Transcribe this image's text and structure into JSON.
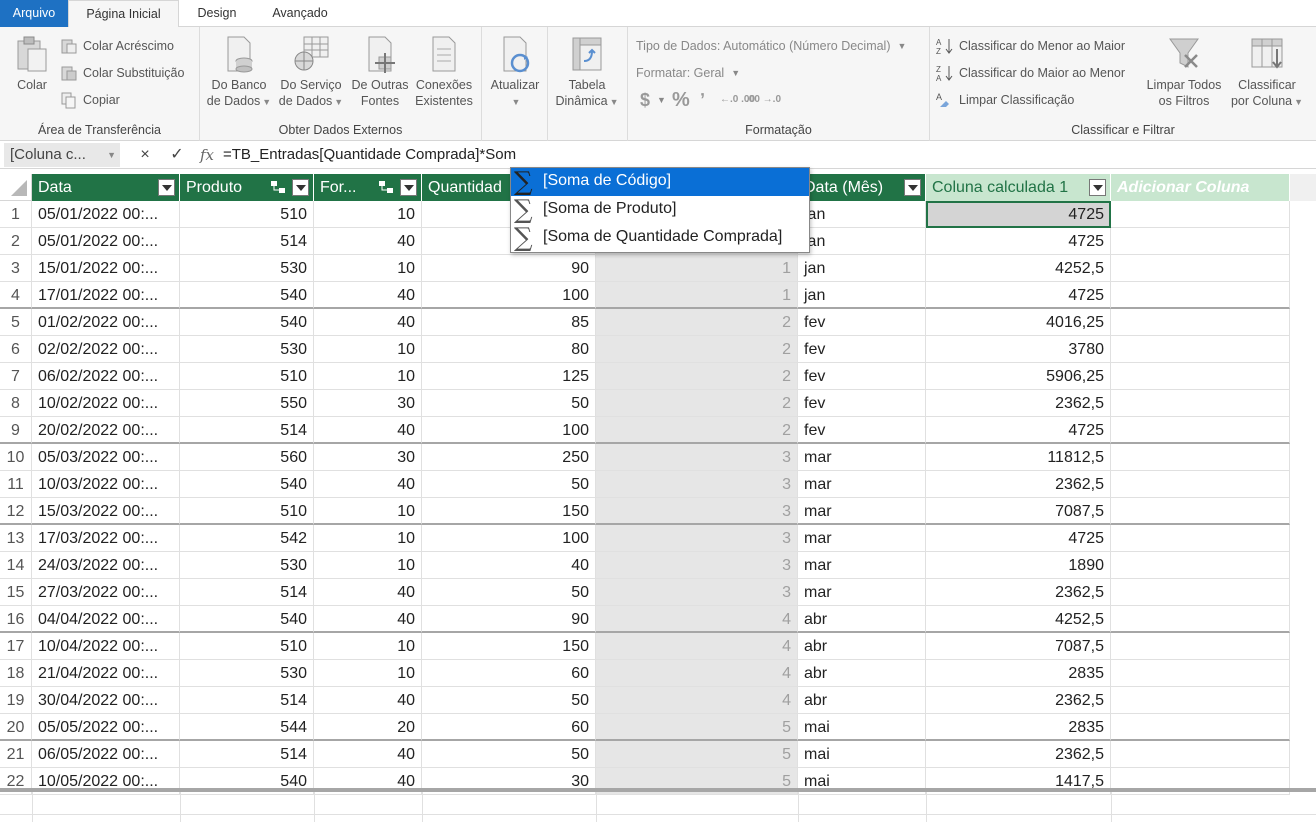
{
  "tabs": [
    {
      "label": "Arquivo"
    },
    {
      "label": "Página Inicial"
    },
    {
      "label": "Design"
    },
    {
      "label": "Avançado"
    }
  ],
  "ribbon": {
    "clipboard": {
      "paste_label": "Colar",
      "paste_append": "Colar Acréscimo",
      "paste_replace": "Colar Substituição",
      "copy": "Copiar",
      "group": "Área de Transferência"
    },
    "external": {
      "from_db_1": "Do Banco",
      "from_db_2": "de Dados",
      "from_service_1": "Do Serviço",
      "from_service_2": "de Dados",
      "other_1": "De Outras",
      "other_2": "Fontes",
      "existing_1": "Conexões",
      "existing_2": "Existentes",
      "group": "Obter Dados Externos"
    },
    "refresh_label": "Atualizar",
    "pivot_1": "Tabela",
    "pivot_2": "Dinâmica",
    "formatting": {
      "data_type": "Tipo de Dados: Automático (Número Decimal)",
      "format": "Formatar: Geral",
      "currency": "$",
      "percent": "%",
      "comma": "ʼ",
      "inc_decimal": "←.0 .00",
      "dec_decimal": ".00 →.0",
      "group": "Formatação"
    },
    "sort": {
      "asc": "Classificar do Menor ao Maior",
      "desc": "Classificar do Maior ao Menor",
      "clear": "Limpar Classificação",
      "clear_filters_1": "Limpar Todos",
      "clear_filters_2": "os Filtros",
      "by_col_1": "Classificar",
      "by_col_2": "por Coluna",
      "group": "Classificar e Filtrar"
    }
  },
  "formula_bar": {
    "name_box": "[Coluna c...",
    "cancel": "×",
    "confirm": "✓",
    "fx": "fx",
    "formula": "=TB_Entradas[Quantidade Comprada]*Som"
  },
  "columns": [
    {
      "label": "Data"
    },
    {
      "label": "Produto"
    },
    {
      "label": "For..."
    },
    {
      "label": "Quantidad"
    },
    {
      "label": ""
    },
    {
      "label": "Data (Mês)"
    },
    {
      "label": "Coluna calculada 1"
    },
    {
      "label": "Adicionar Coluna"
    }
  ],
  "autocomplete": [
    {
      "label": "[Soma de Código]"
    },
    {
      "label": "[Soma de Produto]"
    },
    {
      "label": "[Soma de Quantidade Comprada]"
    }
  ],
  "rows": [
    {
      "n": "1",
      "date": "05/01/2022 00:...",
      "prod": "510",
      "forn": "10",
      "qty": "",
      "m": "",
      "mes": "jan",
      "calc": "4725"
    },
    {
      "n": "2",
      "date": "05/01/2022 00:...",
      "prod": "514",
      "forn": "40",
      "qty": "",
      "m": "",
      "mes": "jan",
      "calc": "4725"
    },
    {
      "n": "3",
      "date": "15/01/2022 00:...",
      "prod": "530",
      "forn": "10",
      "qty": "90",
      "m": "1",
      "mes": "jan",
      "calc": "4252,5"
    },
    {
      "n": "4",
      "date": "17/01/2022 00:...",
      "prod": "540",
      "forn": "40",
      "qty": "100",
      "m": "1",
      "mes": "jan",
      "calc": "4725"
    },
    {
      "n": "5",
      "date": "01/02/2022 00:...",
      "prod": "540",
      "forn": "40",
      "qty": "85",
      "m": "2",
      "mes": "fev",
      "calc": "4016,25"
    },
    {
      "n": "6",
      "date": "02/02/2022 00:...",
      "prod": "530",
      "forn": "10",
      "qty": "80",
      "m": "2",
      "mes": "fev",
      "calc": "3780"
    },
    {
      "n": "7",
      "date": "06/02/2022 00:...",
      "prod": "510",
      "forn": "10",
      "qty": "125",
      "m": "2",
      "mes": "fev",
      "calc": "5906,25"
    },
    {
      "n": "8",
      "date": "10/02/2022 00:...",
      "prod": "550",
      "forn": "30",
      "qty": "50",
      "m": "2",
      "mes": "fev",
      "calc": "2362,5"
    },
    {
      "n": "9",
      "date": "20/02/2022 00:...",
      "prod": "514",
      "forn": "40",
      "qty": "100",
      "m": "2",
      "mes": "fev",
      "calc": "4725"
    },
    {
      "n": "10",
      "date": "05/03/2022 00:...",
      "prod": "560",
      "forn": "30",
      "qty": "250",
      "m": "3",
      "mes": "mar",
      "calc": "11812,5"
    },
    {
      "n": "11",
      "date": "10/03/2022 00:...",
      "prod": "540",
      "forn": "40",
      "qty": "50",
      "m": "3",
      "mes": "mar",
      "calc": "2362,5"
    },
    {
      "n": "12",
      "date": "15/03/2022 00:...",
      "prod": "510",
      "forn": "10",
      "qty": "150",
      "m": "3",
      "mes": "mar",
      "calc": "7087,5"
    },
    {
      "n": "13",
      "date": "17/03/2022 00:...",
      "prod": "542",
      "forn": "10",
      "qty": "100",
      "m": "3",
      "mes": "mar",
      "calc": "4725"
    },
    {
      "n": "14",
      "date": "24/03/2022 00:...",
      "prod": "530",
      "forn": "10",
      "qty": "40",
      "m": "3",
      "mes": "mar",
      "calc": "1890"
    },
    {
      "n": "15",
      "date": "27/03/2022 00:...",
      "prod": "514",
      "forn": "40",
      "qty": "50",
      "m": "3",
      "mes": "mar",
      "calc": "2362,5"
    },
    {
      "n": "16",
      "date": "04/04/2022 00:...",
      "prod": "540",
      "forn": "40",
      "qty": "90",
      "m": "4",
      "mes": "abr",
      "calc": "4252,5"
    },
    {
      "n": "17",
      "date": "10/04/2022 00:...",
      "prod": "510",
      "forn": "10",
      "qty": "150",
      "m": "4",
      "mes": "abr",
      "calc": "7087,5"
    },
    {
      "n": "18",
      "date": "21/04/2022 00:...",
      "prod": "530",
      "forn": "10",
      "qty": "60",
      "m": "4",
      "mes": "abr",
      "calc": "2835"
    },
    {
      "n": "19",
      "date": "30/04/2022 00:...",
      "prod": "514",
      "forn": "40",
      "qty": "50",
      "m": "4",
      "mes": "abr",
      "calc": "2362,5"
    },
    {
      "n": "20",
      "date": "05/05/2022 00:...",
      "prod": "544",
      "forn": "20",
      "qty": "60",
      "m": "5",
      "mes": "mai",
      "calc": "2835"
    },
    {
      "n": "21",
      "date": "06/05/2022 00:...",
      "prod": "514",
      "forn": "40",
      "qty": "50",
      "m": "5",
      "mes": "mai",
      "calc": "2362,5"
    },
    {
      "n": "22",
      "date": "10/05/2022 00:...",
      "prod": "540",
      "forn": "40",
      "qty": "30",
      "m": "5",
      "mes": "mai",
      "calc": "1417,5"
    }
  ],
  "colors": {
    "header_green": "#217346",
    "header_light": "#c8e6cf",
    "file_blue": "#1e71c3",
    "highlight": "#0a6fd6"
  }
}
